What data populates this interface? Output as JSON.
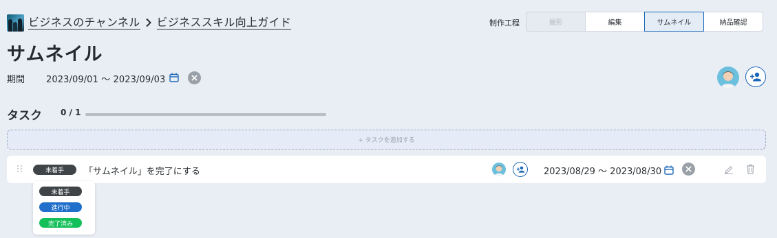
{
  "breadcrumb": {
    "channel": "ビジネスのチャンネル",
    "project": "ビジネススキル向上ガイド"
  },
  "page": {
    "title": "サムネイル"
  },
  "stages": {
    "label": "制作工程",
    "items": [
      "撮影",
      "編集",
      "サムネイル",
      "納品確認"
    ],
    "active": "サムネイル"
  },
  "period": {
    "label": "期間",
    "value": "2023/09/01 〜 2023/09/03"
  },
  "tasks": {
    "heading": "タスク",
    "count": "0 / 1",
    "progress": 0,
    "add_label": "+ タスクを追加する",
    "rows": [
      {
        "status": "未着手",
        "name": "「サムネイル」を完了にする",
        "dates": "2023/08/29 〜 2023/08/30"
      }
    ]
  },
  "status_menu": {
    "options": [
      {
        "label": "未着手",
        "color": "#3f4449"
      },
      {
        "label": "進行中",
        "color": "#1f6fcb"
      },
      {
        "label": "完了済み",
        "color": "#14c05a"
      }
    ]
  },
  "colors": {
    "accent": "#1c68b8",
    "background": "#e9edf4"
  },
  "icons": [
    "channel-logo",
    "chevron-right-icon",
    "calendar-icon",
    "close-circle-icon",
    "avatar",
    "add-user-icon",
    "drag-handle-icon",
    "edit-icon",
    "trash-icon"
  ]
}
